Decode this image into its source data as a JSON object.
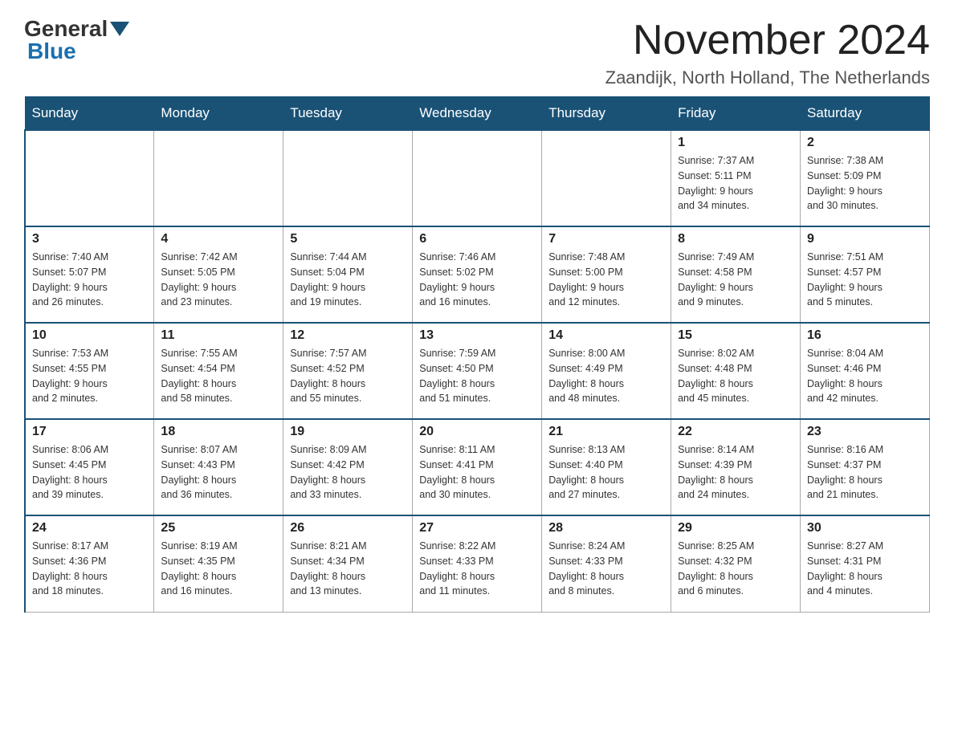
{
  "header": {
    "logo_general": "General",
    "logo_blue": "Blue",
    "month_title": "November 2024",
    "location": "Zaandijk, North Holland, The Netherlands"
  },
  "days_of_week": [
    "Sunday",
    "Monday",
    "Tuesday",
    "Wednesday",
    "Thursday",
    "Friday",
    "Saturday"
  ],
  "weeks": [
    [
      {
        "day": "",
        "info": ""
      },
      {
        "day": "",
        "info": ""
      },
      {
        "day": "",
        "info": ""
      },
      {
        "day": "",
        "info": ""
      },
      {
        "day": "",
        "info": ""
      },
      {
        "day": "1",
        "info": "Sunrise: 7:37 AM\nSunset: 5:11 PM\nDaylight: 9 hours\nand 34 minutes."
      },
      {
        "day": "2",
        "info": "Sunrise: 7:38 AM\nSunset: 5:09 PM\nDaylight: 9 hours\nand 30 minutes."
      }
    ],
    [
      {
        "day": "3",
        "info": "Sunrise: 7:40 AM\nSunset: 5:07 PM\nDaylight: 9 hours\nand 26 minutes."
      },
      {
        "day": "4",
        "info": "Sunrise: 7:42 AM\nSunset: 5:05 PM\nDaylight: 9 hours\nand 23 minutes."
      },
      {
        "day": "5",
        "info": "Sunrise: 7:44 AM\nSunset: 5:04 PM\nDaylight: 9 hours\nand 19 minutes."
      },
      {
        "day": "6",
        "info": "Sunrise: 7:46 AM\nSunset: 5:02 PM\nDaylight: 9 hours\nand 16 minutes."
      },
      {
        "day": "7",
        "info": "Sunrise: 7:48 AM\nSunset: 5:00 PM\nDaylight: 9 hours\nand 12 minutes."
      },
      {
        "day": "8",
        "info": "Sunrise: 7:49 AM\nSunset: 4:58 PM\nDaylight: 9 hours\nand 9 minutes."
      },
      {
        "day": "9",
        "info": "Sunrise: 7:51 AM\nSunset: 4:57 PM\nDaylight: 9 hours\nand 5 minutes."
      }
    ],
    [
      {
        "day": "10",
        "info": "Sunrise: 7:53 AM\nSunset: 4:55 PM\nDaylight: 9 hours\nand 2 minutes."
      },
      {
        "day": "11",
        "info": "Sunrise: 7:55 AM\nSunset: 4:54 PM\nDaylight: 8 hours\nand 58 minutes."
      },
      {
        "day": "12",
        "info": "Sunrise: 7:57 AM\nSunset: 4:52 PM\nDaylight: 8 hours\nand 55 minutes."
      },
      {
        "day": "13",
        "info": "Sunrise: 7:59 AM\nSunset: 4:50 PM\nDaylight: 8 hours\nand 51 minutes."
      },
      {
        "day": "14",
        "info": "Sunrise: 8:00 AM\nSunset: 4:49 PM\nDaylight: 8 hours\nand 48 minutes."
      },
      {
        "day": "15",
        "info": "Sunrise: 8:02 AM\nSunset: 4:48 PM\nDaylight: 8 hours\nand 45 minutes."
      },
      {
        "day": "16",
        "info": "Sunrise: 8:04 AM\nSunset: 4:46 PM\nDaylight: 8 hours\nand 42 minutes."
      }
    ],
    [
      {
        "day": "17",
        "info": "Sunrise: 8:06 AM\nSunset: 4:45 PM\nDaylight: 8 hours\nand 39 minutes."
      },
      {
        "day": "18",
        "info": "Sunrise: 8:07 AM\nSunset: 4:43 PM\nDaylight: 8 hours\nand 36 minutes."
      },
      {
        "day": "19",
        "info": "Sunrise: 8:09 AM\nSunset: 4:42 PM\nDaylight: 8 hours\nand 33 minutes."
      },
      {
        "day": "20",
        "info": "Sunrise: 8:11 AM\nSunset: 4:41 PM\nDaylight: 8 hours\nand 30 minutes."
      },
      {
        "day": "21",
        "info": "Sunrise: 8:13 AM\nSunset: 4:40 PM\nDaylight: 8 hours\nand 27 minutes."
      },
      {
        "day": "22",
        "info": "Sunrise: 8:14 AM\nSunset: 4:39 PM\nDaylight: 8 hours\nand 24 minutes."
      },
      {
        "day": "23",
        "info": "Sunrise: 8:16 AM\nSunset: 4:37 PM\nDaylight: 8 hours\nand 21 minutes."
      }
    ],
    [
      {
        "day": "24",
        "info": "Sunrise: 8:17 AM\nSunset: 4:36 PM\nDaylight: 8 hours\nand 18 minutes."
      },
      {
        "day": "25",
        "info": "Sunrise: 8:19 AM\nSunset: 4:35 PM\nDaylight: 8 hours\nand 16 minutes."
      },
      {
        "day": "26",
        "info": "Sunrise: 8:21 AM\nSunset: 4:34 PM\nDaylight: 8 hours\nand 13 minutes."
      },
      {
        "day": "27",
        "info": "Sunrise: 8:22 AM\nSunset: 4:33 PM\nDaylight: 8 hours\nand 11 minutes."
      },
      {
        "day": "28",
        "info": "Sunrise: 8:24 AM\nSunset: 4:33 PM\nDaylight: 8 hours\nand 8 minutes."
      },
      {
        "day": "29",
        "info": "Sunrise: 8:25 AM\nSunset: 4:32 PM\nDaylight: 8 hours\nand 6 minutes."
      },
      {
        "day": "30",
        "info": "Sunrise: 8:27 AM\nSunset: 4:31 PM\nDaylight: 8 hours\nand 4 minutes."
      }
    ]
  ]
}
